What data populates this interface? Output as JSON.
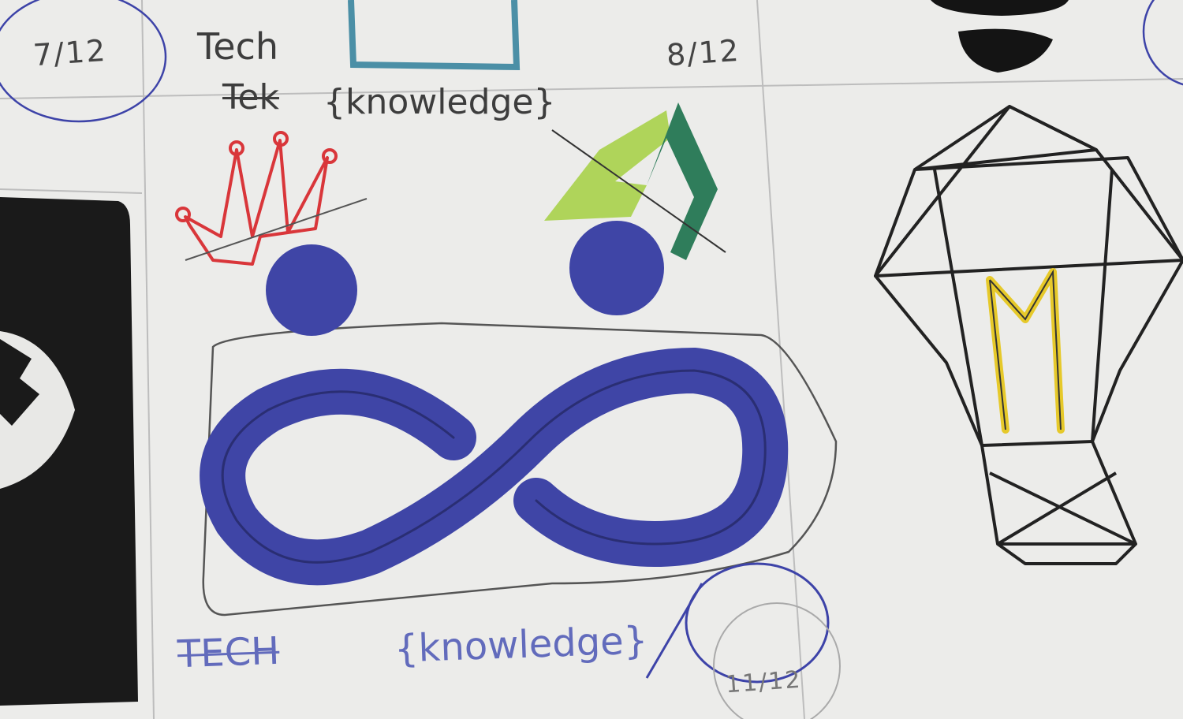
{
  "sheet": {
    "date_left": "7/12",
    "date_mid": "8/12",
    "date_bottom": "11/12"
  },
  "sketch": {
    "title": "Tech",
    "struck_word": "Tek",
    "subtitle": "{knowledge}",
    "bottom_text_struck": "TECH",
    "bottom_text": "{knowledge}"
  },
  "colors": {
    "paper": "#ececea",
    "grid": "#bdbdbd",
    "ink_blue": "#3f45a6",
    "crown_red": "#d9363a",
    "lime": "#a9d14a",
    "green": "#2f7d5b",
    "bulb_yellow": "#e6c92a",
    "charcoal": "#1a1a1a"
  }
}
